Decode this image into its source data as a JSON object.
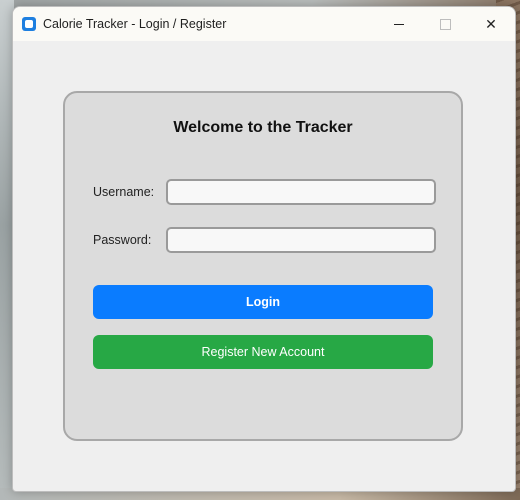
{
  "window": {
    "title": "Calorie Tracker - Login / Register",
    "icon": "app-icon",
    "controls": {
      "minimize_icon": "minimize-icon",
      "maximize_icon": "maximize-icon",
      "close_icon": "close-icon",
      "close_glyph": "✕"
    }
  },
  "panel": {
    "title": "Welcome to the Tracker",
    "username_label": "Username:",
    "username_value": "",
    "password_label": "Password:",
    "password_value": "",
    "login_label": "Login",
    "register_label": "Register New Account"
  },
  "colors": {
    "login_button": "#0a7cff",
    "register_button": "#27a845",
    "panel_background": "#dcdcdc"
  }
}
